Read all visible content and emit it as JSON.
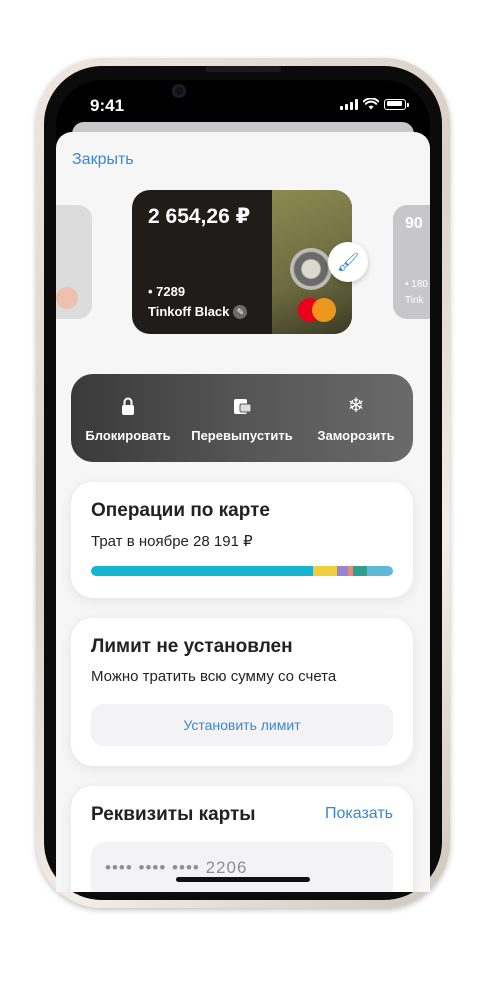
{
  "status_bar": {
    "time": "9:41"
  },
  "header": {
    "close_label": "Закрыть"
  },
  "cards": {
    "current": {
      "balance": "2 654,26 ₽",
      "number": "• 7289",
      "name": "Tinkoff Black"
    },
    "next": {
      "balance": "90",
      "number": "• 180",
      "name": "Tink"
    }
  },
  "actions": [
    {
      "label": "Блокировать",
      "icon": "lock-icon"
    },
    {
      "label": "Перевыпустить",
      "icon": "reissue-card-icon"
    },
    {
      "label": "Заморозить",
      "icon": "snowflake-icon"
    }
  ],
  "operations": {
    "title": "Операции по карте",
    "subtitle": "Трат в ноябре 28 191 ₽",
    "spend_bar": [
      {
        "share": 0.735,
        "color": "#17b3d3"
      },
      {
        "share": 0.08,
        "color": "#f0cf3c"
      },
      {
        "share": 0.035,
        "color": "#9a85d2"
      },
      {
        "share": 0.018,
        "color": "#e08b84"
      },
      {
        "share": 0.045,
        "color": "#2f9f8f"
      },
      {
        "share": 0.087,
        "color": "#5fb8d8"
      }
    ]
  },
  "limit": {
    "title": "Лимит не установлен",
    "subtitle": "Можно тратить всю сумму со счета",
    "button_label": "Установить лимит"
  },
  "requisites": {
    "title": "Реквизиты карты",
    "show_label": "Показать",
    "masked_number": "•••• •••• •••• 2206"
  },
  "colors": {
    "accent": "#3b86d4",
    "card_bg": "#1f1c1a"
  }
}
